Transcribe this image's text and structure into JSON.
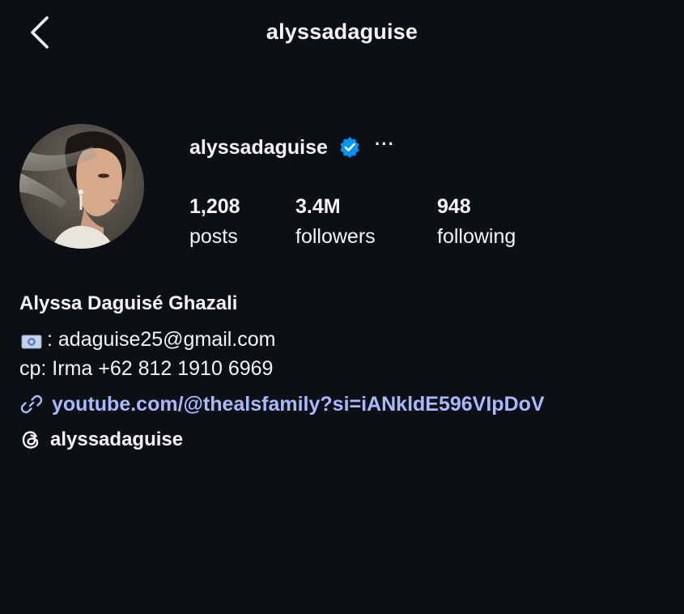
{
  "header": {
    "title": "alyssadaguise",
    "back_icon": "chevron-left-icon"
  },
  "profile": {
    "username": "alyssadaguise",
    "verified_icon": "verified-badge-icon",
    "verified_color": "#0095f6",
    "more_label": "···",
    "avatar_icon": "profile-photo"
  },
  "stats": [
    {
      "value": "1,208",
      "label": "posts"
    },
    {
      "value": "3.4M",
      "label": "followers"
    },
    {
      "value": "948",
      "label": "following"
    }
  ],
  "bio": {
    "full_name": "Alyssa Daguisé Ghazali",
    "email_icon": "envelope-emoji-icon",
    "email_text": ": adaguise25@gmail.com",
    "phone_text": "cp: Irma +62 812 1910 6969"
  },
  "link": {
    "icon": "link-icon",
    "text": "youtube.com/@thealsfamily?si=iANkldE596VIpDoV",
    "color": "#a8b9ff"
  },
  "threads": {
    "icon": "threads-icon",
    "handle": "alyssadaguise"
  }
}
